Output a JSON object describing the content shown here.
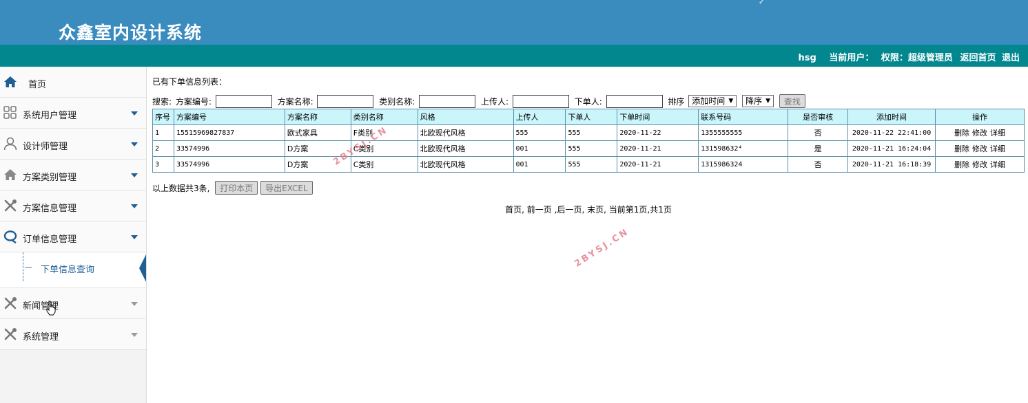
{
  "header": {
    "title": "众鑫室内设计系统"
  },
  "topbar": {
    "username": "hsg",
    "current_user_label": "当前用户：",
    "role_label": "权限：超级管理员",
    "home_link": "返回首页",
    "logout_link": "退出"
  },
  "sidebar": {
    "items": [
      {
        "label": "首页",
        "icon": "home-icon"
      },
      {
        "label": "系统用户管理",
        "icon": "grid-icon"
      },
      {
        "label": "设计师管理",
        "icon": "user-icon"
      },
      {
        "label": "方案类别管理",
        "icon": "home-outline-icon"
      },
      {
        "label": "方案信息管理",
        "icon": "tools-icon"
      },
      {
        "label": "订单信息管理",
        "icon": "chat-icon"
      },
      {
        "label": "新闻管理",
        "icon": "tools-icon"
      },
      {
        "label": "系统管理",
        "icon": "tools-icon"
      }
    ],
    "submenu": {
      "label": "下单信息查询"
    }
  },
  "main": {
    "list_title": "已有下单信息列表：",
    "search": {
      "prefix": "搜索:",
      "fields": [
        "方案编号:",
        "方案名称:",
        "类别名称:",
        "上传人:",
        "下单人:"
      ],
      "sort_label": "排序",
      "sort_field": "添加时间",
      "sort_order": "降序",
      "button": "查找"
    },
    "table": {
      "headers": [
        "序号",
        "方案编号",
        "方案名称",
        "类别名称",
        "风格",
        "上传人",
        "下单人",
        "下单时间",
        "联系号码",
        "是否审核",
        "添加时间",
        "操作"
      ],
      "rows": [
        [
          "1",
          "15515969827837",
          "欧式家具",
          "F类别",
          "北欧现代风格",
          "555",
          "555",
          "2020-11-22",
          "1355555555",
          "否",
          "2020-11-22 22:41:00"
        ],
        [
          "2",
          "33574996",
          "D方案",
          "C类别",
          "北欧现代风格",
          "001",
          "555",
          "2020-11-21",
          "131598632⁴",
          "是",
          "2020-11-21 16:24:04"
        ],
        [
          "3",
          "33574996",
          "D方案",
          "C类别",
          "北欧现代风格",
          "001",
          "555",
          "2020-11-21",
          "1315986324",
          "否",
          "2020-11-21 16:18:39"
        ]
      ],
      "row_actions": [
        "删除",
        "修改",
        "详细"
      ]
    },
    "summary": "以上数据共3条,",
    "print_button": "打印本页",
    "export_button": "导出EXCEL",
    "pager": {
      "first": "首页,",
      "prev": "前一页",
      "next": ",后一页,",
      "last": "末页,",
      "info": "当前第1页,共1页"
    }
  },
  "watermark": "2BYSJ.CN"
}
